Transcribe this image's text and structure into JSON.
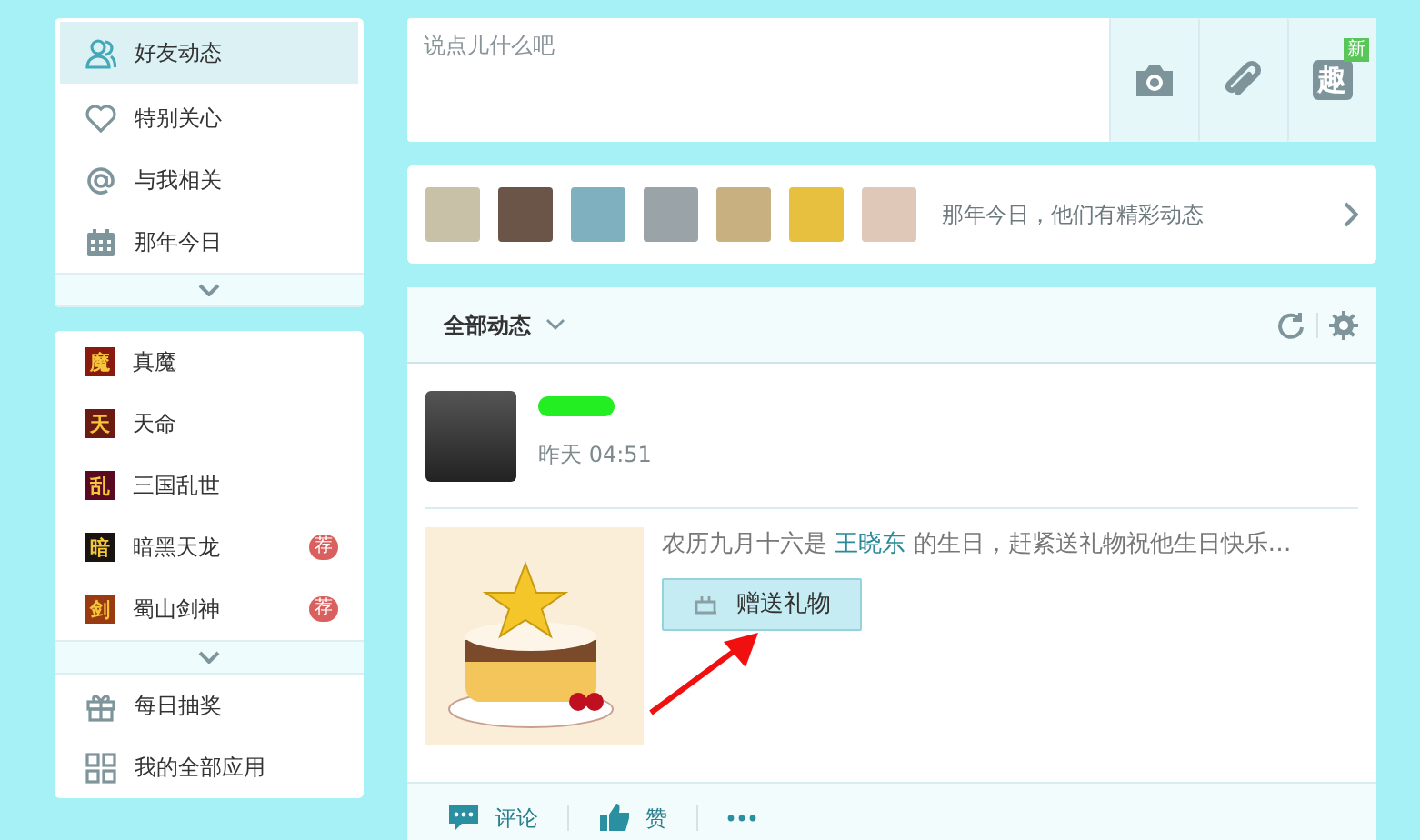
{
  "sidebar_nav": {
    "items": [
      {
        "label": "好友动态",
        "kind": "friends",
        "selected": true
      },
      {
        "label": "特别关心",
        "kind": "heart",
        "selected": false
      },
      {
        "label": "与我相关",
        "kind": "at",
        "selected": false
      },
      {
        "label": "那年今日",
        "kind": "calendar",
        "selected": false
      }
    ]
  },
  "apps": {
    "items": [
      {
        "label": "真魔",
        "glyph": "魔",
        "color": "#8a1a10"
      },
      {
        "label": "天命",
        "glyph": "天",
        "color": "#6a1a10"
      },
      {
        "label": "三国乱世",
        "glyph": "乱",
        "color": "#5a0a20"
      },
      {
        "label": "暗黑天龙",
        "glyph": "暗",
        "color": "#1a1410",
        "badge": "荐"
      },
      {
        "label": "蜀山剑神",
        "glyph": "剑",
        "color": "#9a3a10",
        "badge": "荐"
      }
    ],
    "more": [
      {
        "label": "每日抽奖",
        "kind": "gift"
      },
      {
        "label": "我的全部应用",
        "kind": "grid"
      }
    ]
  },
  "composer": {
    "placeholder": "说点儿什么吧",
    "tools": [
      {
        "kind": "camera"
      },
      {
        "kind": "link"
      },
      {
        "kind": "glyph",
        "glyph": "趣",
        "badge": "新"
      }
    ]
  },
  "memories": {
    "text": "那年今日，他们有精彩动态"
  },
  "feed": {
    "filter": "全部动态",
    "post": {
      "time": "昨天 04:51",
      "text_before": "农历九月十六是 ",
      "name_link": "王晓东",
      "text_after": " 的生日，赶紧送礼物祝他生日快乐…",
      "gift_button": "赠送礼物"
    },
    "actions": [
      {
        "kind": "comment",
        "label": "评论"
      },
      {
        "kind": "like",
        "label": "赞"
      },
      {
        "kind": "more"
      }
    ]
  }
}
